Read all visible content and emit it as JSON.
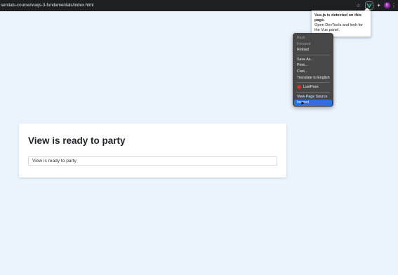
{
  "browser": {
    "url": "sentials-course/vuejs-3-fundamentals/index.html",
    "avatar_letter": "D"
  },
  "tooltip": {
    "title": "Vue.js is detected on this page.",
    "body": "Open DevTools and look for the Vue panel."
  },
  "context_menu": {
    "items": [
      {
        "label": "Back"
      },
      {
        "label": "Forward"
      },
      {
        "label": "Reload"
      },
      {
        "label": "Save As..."
      },
      {
        "label": "Print..."
      },
      {
        "label": "Cast..."
      },
      {
        "label": "Translate to English"
      },
      {
        "label": "LastPass"
      },
      {
        "label": "View Page Source"
      },
      {
        "label": "Inspect"
      }
    ],
    "lastpass_badge": "..."
  },
  "page": {
    "heading": "View is ready to party",
    "input_value": "View is ready to party"
  },
  "colors": {
    "background": "#e9f4fd",
    "menu_highlight": "#2d6fe0",
    "vue_green": "#42b883"
  }
}
